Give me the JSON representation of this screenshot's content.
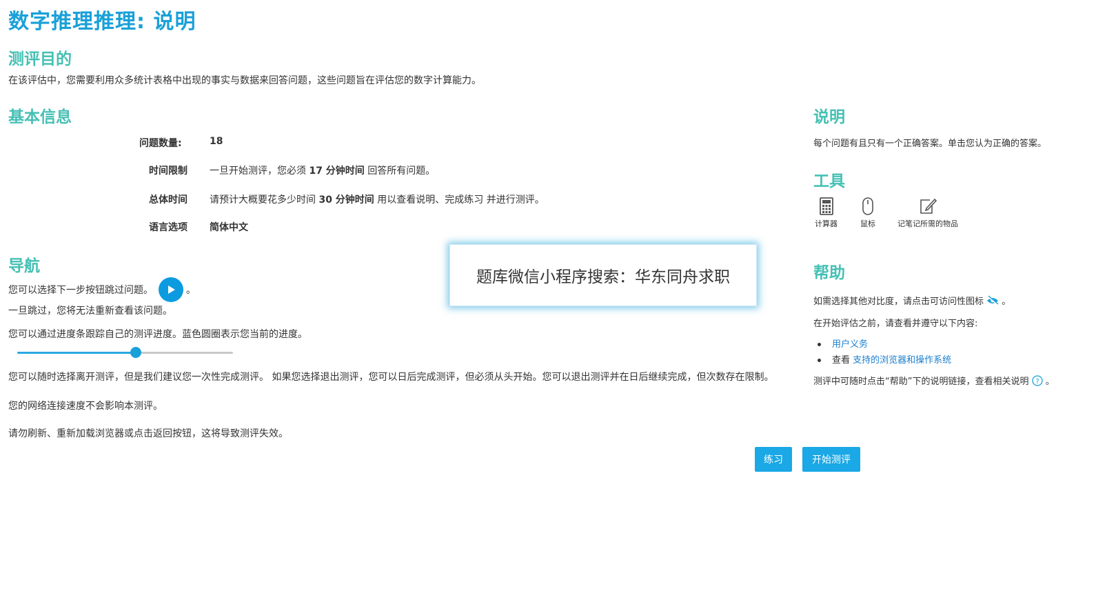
{
  "page": {
    "title": "数字推理推理: 说明"
  },
  "purpose": {
    "heading": "测评目的",
    "text": "在该评估中，您需要利用众多统计表格中出现的事实与数据来回答问题，这些问题旨在评估您的数字计算能力。"
  },
  "basic_info": {
    "heading": "基本信息",
    "rows": [
      {
        "label": "问题数量:",
        "value": "18"
      },
      {
        "label": "时间限制",
        "value_pre": "一旦开始测评，您必须 ",
        "value_bold": "17 分钟时间",
        "value_post": " 回答所有问题。"
      },
      {
        "label": "总体时间",
        "value_pre": "请预计大概要花多少时间 ",
        "value_bold": "30 分钟时间",
        "value_post": " 用以查看说明、完成练习 并进行测评。"
      },
      {
        "label": "语言选项",
        "value": "简体中文"
      }
    ]
  },
  "navigation": {
    "heading": "导航",
    "skip_text": "您可以选择下一步按钮跳过问题。",
    "skip_suffix": "。",
    "no_review_text": "一旦跳过，您将无法重新查看该问题。",
    "progress_text": "您可以通过进度条跟踪自己的测评进度。蓝色圆圈表示您当前的进度。",
    "progress_fraction": 0.55,
    "leave_text": "您可以随时选择离开测评，但是我们建议您一次性完成测评。 如果您选择退出测评，您可以日后完成测评，但必须从头开始。您可以退出测评并在日后继续完成，但次数存在限制。",
    "network_text": "您的网络连接速度不会影响本测评。",
    "refresh_text": "请勿刷新、重新加载浏览器或点击返回按钮，这将导致测评失效。"
  },
  "popup": {
    "text": "题库微信小程序搜索：华东同舟求职"
  },
  "actions": {
    "practice_label": "练习",
    "start_label": "开始测评"
  },
  "instructions": {
    "heading": "说明",
    "text": "每个问题有且只有一个正确答案。单击您认为正确的答案。"
  },
  "tools": {
    "heading": "工具",
    "items": [
      {
        "label": "计算器",
        "icon": "calculator-icon"
      },
      {
        "label": "鼠标",
        "icon": "mouse-icon"
      },
      {
        "label": "记笔记所需的物品",
        "icon": "note-edit-icon"
      }
    ]
  },
  "help": {
    "heading": "帮助",
    "contrast_text": "如需选择其他对比度，请点击可访问性图标",
    "contrast_suffix": "。",
    "before_text": "在开始评估之前，请查看并遵守以下内容:",
    "links": [
      {
        "prefix": "",
        "label": "用户义务"
      },
      {
        "prefix": "查看 ",
        "label": "支持的浏览器和操作系统"
      }
    ],
    "help_link_text": "测评中可随时点击“帮助”下的说明链接，查看相关说明",
    "help_suffix": "。"
  },
  "colors": {
    "title": "#1aa0d8",
    "heading": "#45c0b4",
    "accent": "#1aa8e6",
    "link": "#1a7fcf"
  }
}
